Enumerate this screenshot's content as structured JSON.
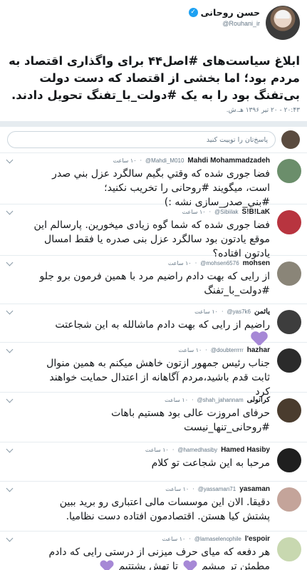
{
  "main_tweet": {
    "author_name": "حسن روحانی",
    "handle": "@Rouhani_ir",
    "text": "ابلاغ سیاست‌های #اصل۴۴ برای واگذاری اقتصاد به مردم بود؛ اما بخشی از اقتصاد که دست دولت بی‌تفنگ بود را به یک #دولت_با_تفنگ تحویل دادند.",
    "time": "۲۰:۴۳ - ۲۰ تیر ۱۳۹۶ هـ.ش."
  },
  "reply_box": {
    "placeholder": "پاسخ‌تان را توییت کنید"
  },
  "replies": [
    {
      "name": "Mahdi Mohammadzadeh",
      "handle": "@Mahdi_M010",
      "time": "۱۰ ساعت",
      "text": "فضا جوری شده که وقتي بگيم سالگرد عزل بني صدر است، ميگويند #روحانی را تخريب نکنيد؛ #بني_صدر_سازی نشه :)",
      "avatar_color": "#6b8e6b"
    },
    {
      "name": "S!B!LaK",
      "handle": "@Sibiilak",
      "time": "۱۰ ساعت",
      "text": "فضا جوری شده که شما گوه زیادی میخورین. پارسالم این موقع یادتون بود سالگرد عزل بنی صدره یا فقط امسال یادتون افتاده؟",
      "avatar_color": "#b8343f"
    },
    {
      "name": "mohsen",
      "handle": "@mohsen6576",
      "time": "۱۰ ساعت",
      "text": "از رایی که بهت دادم راضیم مرد با همین فرمون برو جلو #دولت_با_تفنگ",
      "avatar_color": "#8a8578"
    },
    {
      "name": "یاثمن",
      "handle": "@yas7k6",
      "time": "۱۰ ساعت",
      "text": "راضیم از رایی که بهت دادم ماشالله به این شجاعتت",
      "avatar_color": "#3d3d3d"
    },
    {
      "name": "hazhar",
      "handle": "@doubterrrrr",
      "time": "۱۰ ساعت",
      "text": "جناب رئیس جمهور ازتون خاهش میکنم به همین منوال ثابت قدم باشید،مردم آگاهانه از اعتدال حمایت خواهند کرد",
      "avatar_color": "#2b2b2b"
    },
    {
      "name": "کرانولی",
      "handle": "@shah_jahannam",
      "time": "۱۰ ساعت",
      "text": "حرفای امروزت عالی بود هستیم باهات #روحانی_تنها_نیست",
      "avatar_color": "#4a3c2e"
    },
    {
      "name": "Hamed Hasiby",
      "handle": "@hamedhasiby",
      "time": "۱۰ ساعت",
      "text": "مرحبا به این شجاعت تو کلام",
      "avatar_color": "#1f1f1f"
    },
    {
      "name": "yasaman",
      "handle": "@yassaman71",
      "time": "۱۰ ساعت",
      "text": "دقیقا. الان این موسسات مالی اعتباری رو برید ببین پشتش کیا هستن. اقتصادمون افتاده دست نظامیا.",
      "avatar_color": "#c4a49a"
    },
    {
      "name": "l'espoir",
      "handle": "@lamaselenophile",
      "time": "۱۰ ساعت",
      "text_a": "هر دفعه که میای حرف میزنی از درستی رایی که دادم مطمئن تر میشم",
      "text_b": "تا تهش پشتتیم",
      "avatar_color": "#c8d8b0"
    }
  ]
}
